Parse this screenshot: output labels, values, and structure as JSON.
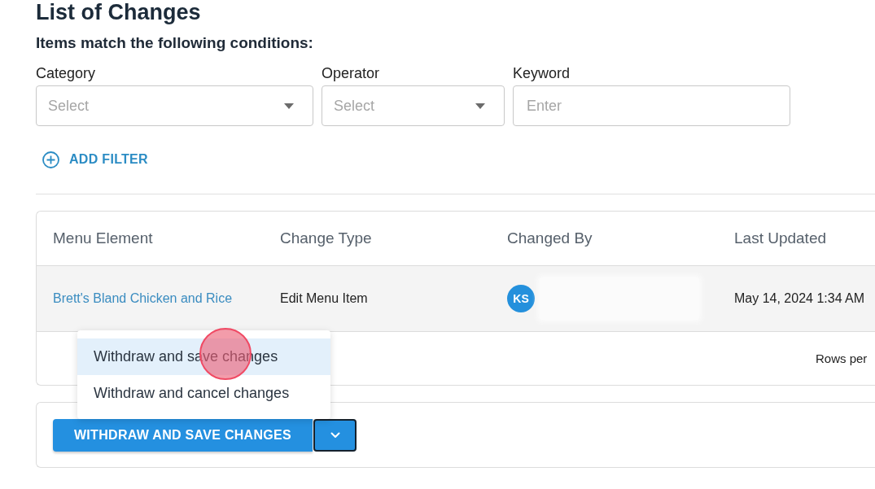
{
  "page": {
    "title": "List of Changes"
  },
  "filters": {
    "heading": "Items match the following conditions:",
    "fields": [
      {
        "kind": "select",
        "label": "Category",
        "placeholder": "Select"
      },
      {
        "kind": "select",
        "label": "Operator",
        "placeholder": "Select"
      },
      {
        "kind": "text",
        "label": "Keyword",
        "placeholder": "Enter"
      }
    ],
    "add_filter": "ADD FILTER"
  },
  "table": {
    "columns": [
      "Menu Element",
      "Change Type",
      "Changed By",
      "Last Updated"
    ],
    "rows": [
      {
        "menu_element": "Brett's Bland Chicken and Rice",
        "change_type": "Edit Menu Item",
        "changed_by": {
          "initials": "KS"
        },
        "last_updated": "May 14, 2024 1:34 AM"
      }
    ],
    "footer": {
      "rows_per_page_label": "Rows per"
    }
  },
  "actions": {
    "menu_items": [
      {
        "label": "Withdraw and save changes",
        "selected": true
      },
      {
        "label": "Withdraw and cancel changes",
        "selected": false
      }
    ],
    "primary_button": "WITHDRAW AND SAVE CHANGES",
    "menu_expanded": true
  }
}
